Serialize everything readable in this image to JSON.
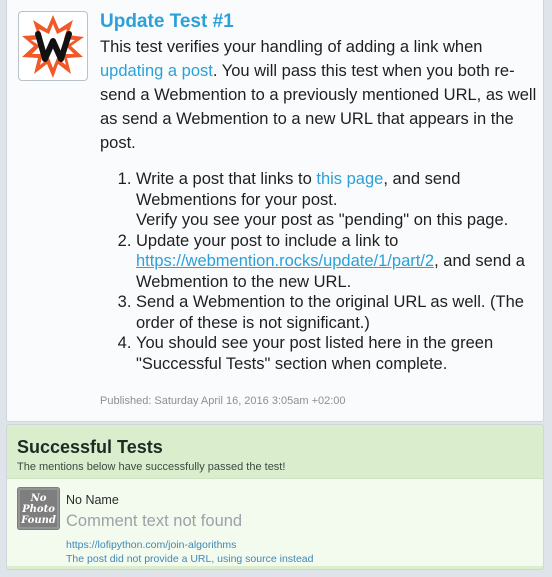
{
  "post": {
    "title": "Update Test #1",
    "intro_before": "This test verifies your handling of adding a link when ",
    "intro_link": "updating a post",
    "intro_after": ". You will pass this test when you both re-send a Webmention to a previously mentioned URL, as well as send a Webmention to a new URL that appears in the post.",
    "steps": [
      {
        "before": "Write a post that links to ",
        "link": "this page",
        "after": ", and send Webmentions for your post.",
        "extra": "Verify you see your post as \"pending\" on this page."
      },
      {
        "before": "Update your post to include a link to ",
        "link": "https://webmention.rocks/update/1/part/2",
        "after": ", and send a Webmention to the new URL."
      },
      {
        "text": "Send a Webmention to the original URL as well. (The order of these is not significant.)"
      },
      {
        "text": "You should see your post listed here in the green \"Successful Tests\" section when complete."
      }
    ],
    "published": "Published: Saturday April 16, 2016 3:05am +02:00"
  },
  "success": {
    "title": "Successful Tests",
    "subtitle": "The mentions below have successfully passed the test!",
    "mention": {
      "author": "No Name",
      "avatar_text": [
        "No",
        "Photo",
        "Found"
      ],
      "comment": "Comment text not found",
      "url": "https://lofipython.com/join-algorithms",
      "note": "The post did not provide a URL, using source instead"
    }
  },
  "colors": {
    "accent": "#2aa1d8",
    "success_bg": "#daeece",
    "page_bg": "#dfe4ea"
  }
}
